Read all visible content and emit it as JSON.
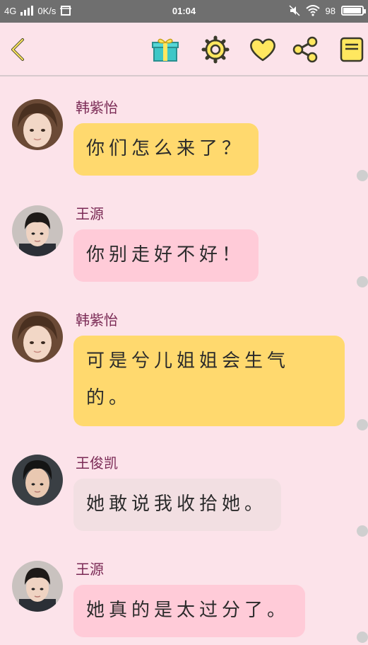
{
  "status_bar": {
    "network": "4G",
    "speed": "0K/s",
    "time": "01:04",
    "battery": "98",
    "battery_level": 0.98
  },
  "toolbar": {
    "icons": [
      "back-icon",
      "gift-icon",
      "gear-icon",
      "heart-icon",
      "share-icon",
      "book-icon"
    ]
  },
  "colors": {
    "background": "#fce3ea",
    "yellow_bubble": "#ffd96e",
    "pink_bubble": "#ffcbd8",
    "gray_bubble": "#f2dfe2",
    "sender_name": "#7a2a55",
    "icon_yellow": "#ffe75f"
  },
  "messages": [
    {
      "sender": "韩紫怡",
      "text": "你们怎么来了？",
      "style": "yellow"
    },
    {
      "sender": "王源",
      "text": "你别走好不好！",
      "style": "pink"
    },
    {
      "sender": "韩紫怡",
      "text": "可是兮儿姐姐会生气的。",
      "style": "yellow"
    },
    {
      "sender": "王俊凯",
      "text": "她敢说我收拾她。",
      "style": "gray"
    },
    {
      "sender": "王源",
      "text": "她真的是太过分了。",
      "style": "pink"
    }
  ]
}
